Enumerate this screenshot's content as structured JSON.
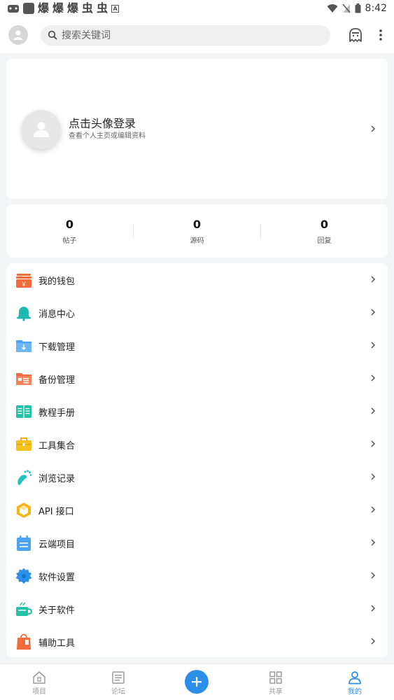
{
  "status_bar": {
    "glyphs": [
      "爆",
      "爆",
      "爆",
      "虫",
      "虫"
    ],
    "box_letter": "A",
    "time": "8:42"
  },
  "search": {
    "placeholder": "搜索关键词"
  },
  "profile": {
    "title": "点击头像登录",
    "subtitle": "查看个人主页或编辑资料"
  },
  "stats": [
    {
      "value": "0",
      "label": "帖子"
    },
    {
      "value": "0",
      "label": "源码"
    },
    {
      "value": "0",
      "label": "回复"
    }
  ],
  "menu": [
    {
      "label": "我的钱包",
      "icon": "wallet-icon",
      "color": "#f26b3a"
    },
    {
      "label": "消息中心",
      "icon": "bell-icon",
      "color": "#1fb8b0"
    },
    {
      "label": "下载管理",
      "icon": "download-folder-icon",
      "color": "#4aa3f5"
    },
    {
      "label": "备份管理",
      "icon": "backup-folder-icon",
      "color": "#f26b3a"
    },
    {
      "label": "教程手册",
      "icon": "book-icon",
      "color": "#23c1a8"
    },
    {
      "label": "工具集合",
      "icon": "toolbox-icon",
      "color": "#f5c21b"
    },
    {
      "label": "浏览记录",
      "icon": "footprint-icon",
      "color": "#23c1c1"
    },
    {
      "label": "API 接口",
      "icon": "cube-icon",
      "color": "#f5b21b"
    },
    {
      "label": "云端项目",
      "icon": "calendar-icon",
      "color": "#4aa3f5"
    },
    {
      "label": "软件设置",
      "icon": "gear-icon",
      "color": "#2b8ee8"
    },
    {
      "label": "关于软件",
      "icon": "cup-icon",
      "color": "#23c1a8"
    },
    {
      "label": "辅助工具",
      "icon": "bag-icon",
      "color": "#f26b3a"
    }
  ],
  "bottom_nav": {
    "items": [
      {
        "label": "项目",
        "icon": "home-icon"
      },
      {
        "label": "论坛",
        "icon": "forum-icon"
      },
      {
        "label": "共享",
        "icon": "grid-icon"
      },
      {
        "label": "我的",
        "icon": "person-icon"
      }
    ],
    "active": "我的",
    "accent": "#2b8ee8"
  }
}
